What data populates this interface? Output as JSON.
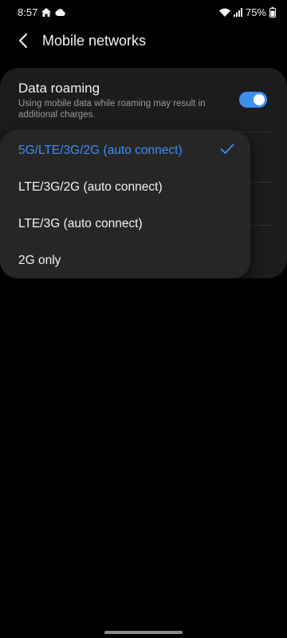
{
  "status_bar": {
    "time": "8:57",
    "battery": "75%",
    "icons": [
      "home-icon",
      "cloud-icon",
      "wifi-icon",
      "signal-icon",
      "battery-icon"
    ]
  },
  "header": {
    "title": "Mobile networks",
    "back_icon": "chevron-left-icon"
  },
  "settings": {
    "data_roaming": {
      "title": "Data roaming",
      "description": "Using mobile data while roaming may result in additional charges.",
      "enabled": true
    }
  },
  "network_mode_dropdown": {
    "options": [
      {
        "label": "5G/LTE/3G/2G (auto connect)",
        "selected": true
      },
      {
        "label": "LTE/3G/2G (auto connect)",
        "selected": false
      },
      {
        "label": "LTE/3G (auto connect)",
        "selected": false
      },
      {
        "label": "2G only",
        "selected": false
      }
    ]
  },
  "colors": {
    "accent": "#3e8ef0",
    "background": "#000000",
    "card": "#1c1c1c",
    "dropdown": "#262626"
  }
}
